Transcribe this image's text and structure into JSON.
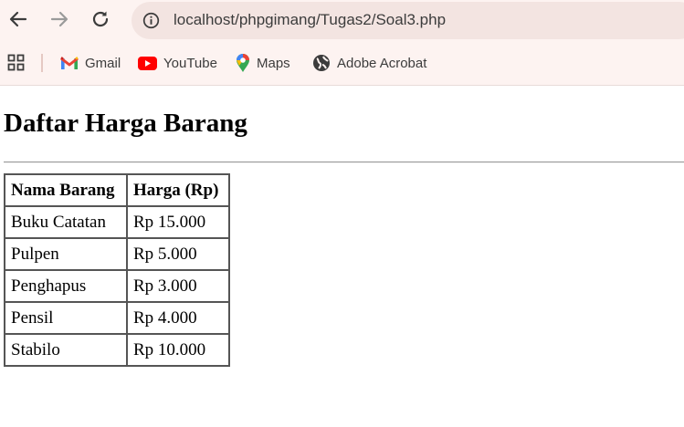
{
  "browser": {
    "url": "localhost/phpgimang/Tugas2/Soal3.php",
    "nav_icons": [
      "back-arrow-icon",
      "forward-arrow-icon",
      "reload-icon"
    ],
    "bookmarks": [
      {
        "label": "Gmail",
        "icon": "gmail-icon"
      },
      {
        "label": "YouTube",
        "icon": "youtube-icon"
      },
      {
        "label": "Maps",
        "icon": "maps-icon"
      },
      {
        "label": "Adobe Acrobat",
        "icon": "globe-icon"
      }
    ]
  },
  "page": {
    "heading": "Daftar Harga Barang",
    "table": {
      "headers": [
        "Nama Barang",
        "Harga (Rp)"
      ],
      "rows": [
        [
          "Buku Catatan",
          "Rp 15.000"
        ],
        [
          "Pulpen",
          "Rp 5.000"
        ],
        [
          "Penghapus",
          "Rp 3.000"
        ],
        [
          "Pensil",
          "Rp 4.000"
        ],
        [
          "Stabilo",
          "Rp 10.000"
        ]
      ]
    }
  }
}
